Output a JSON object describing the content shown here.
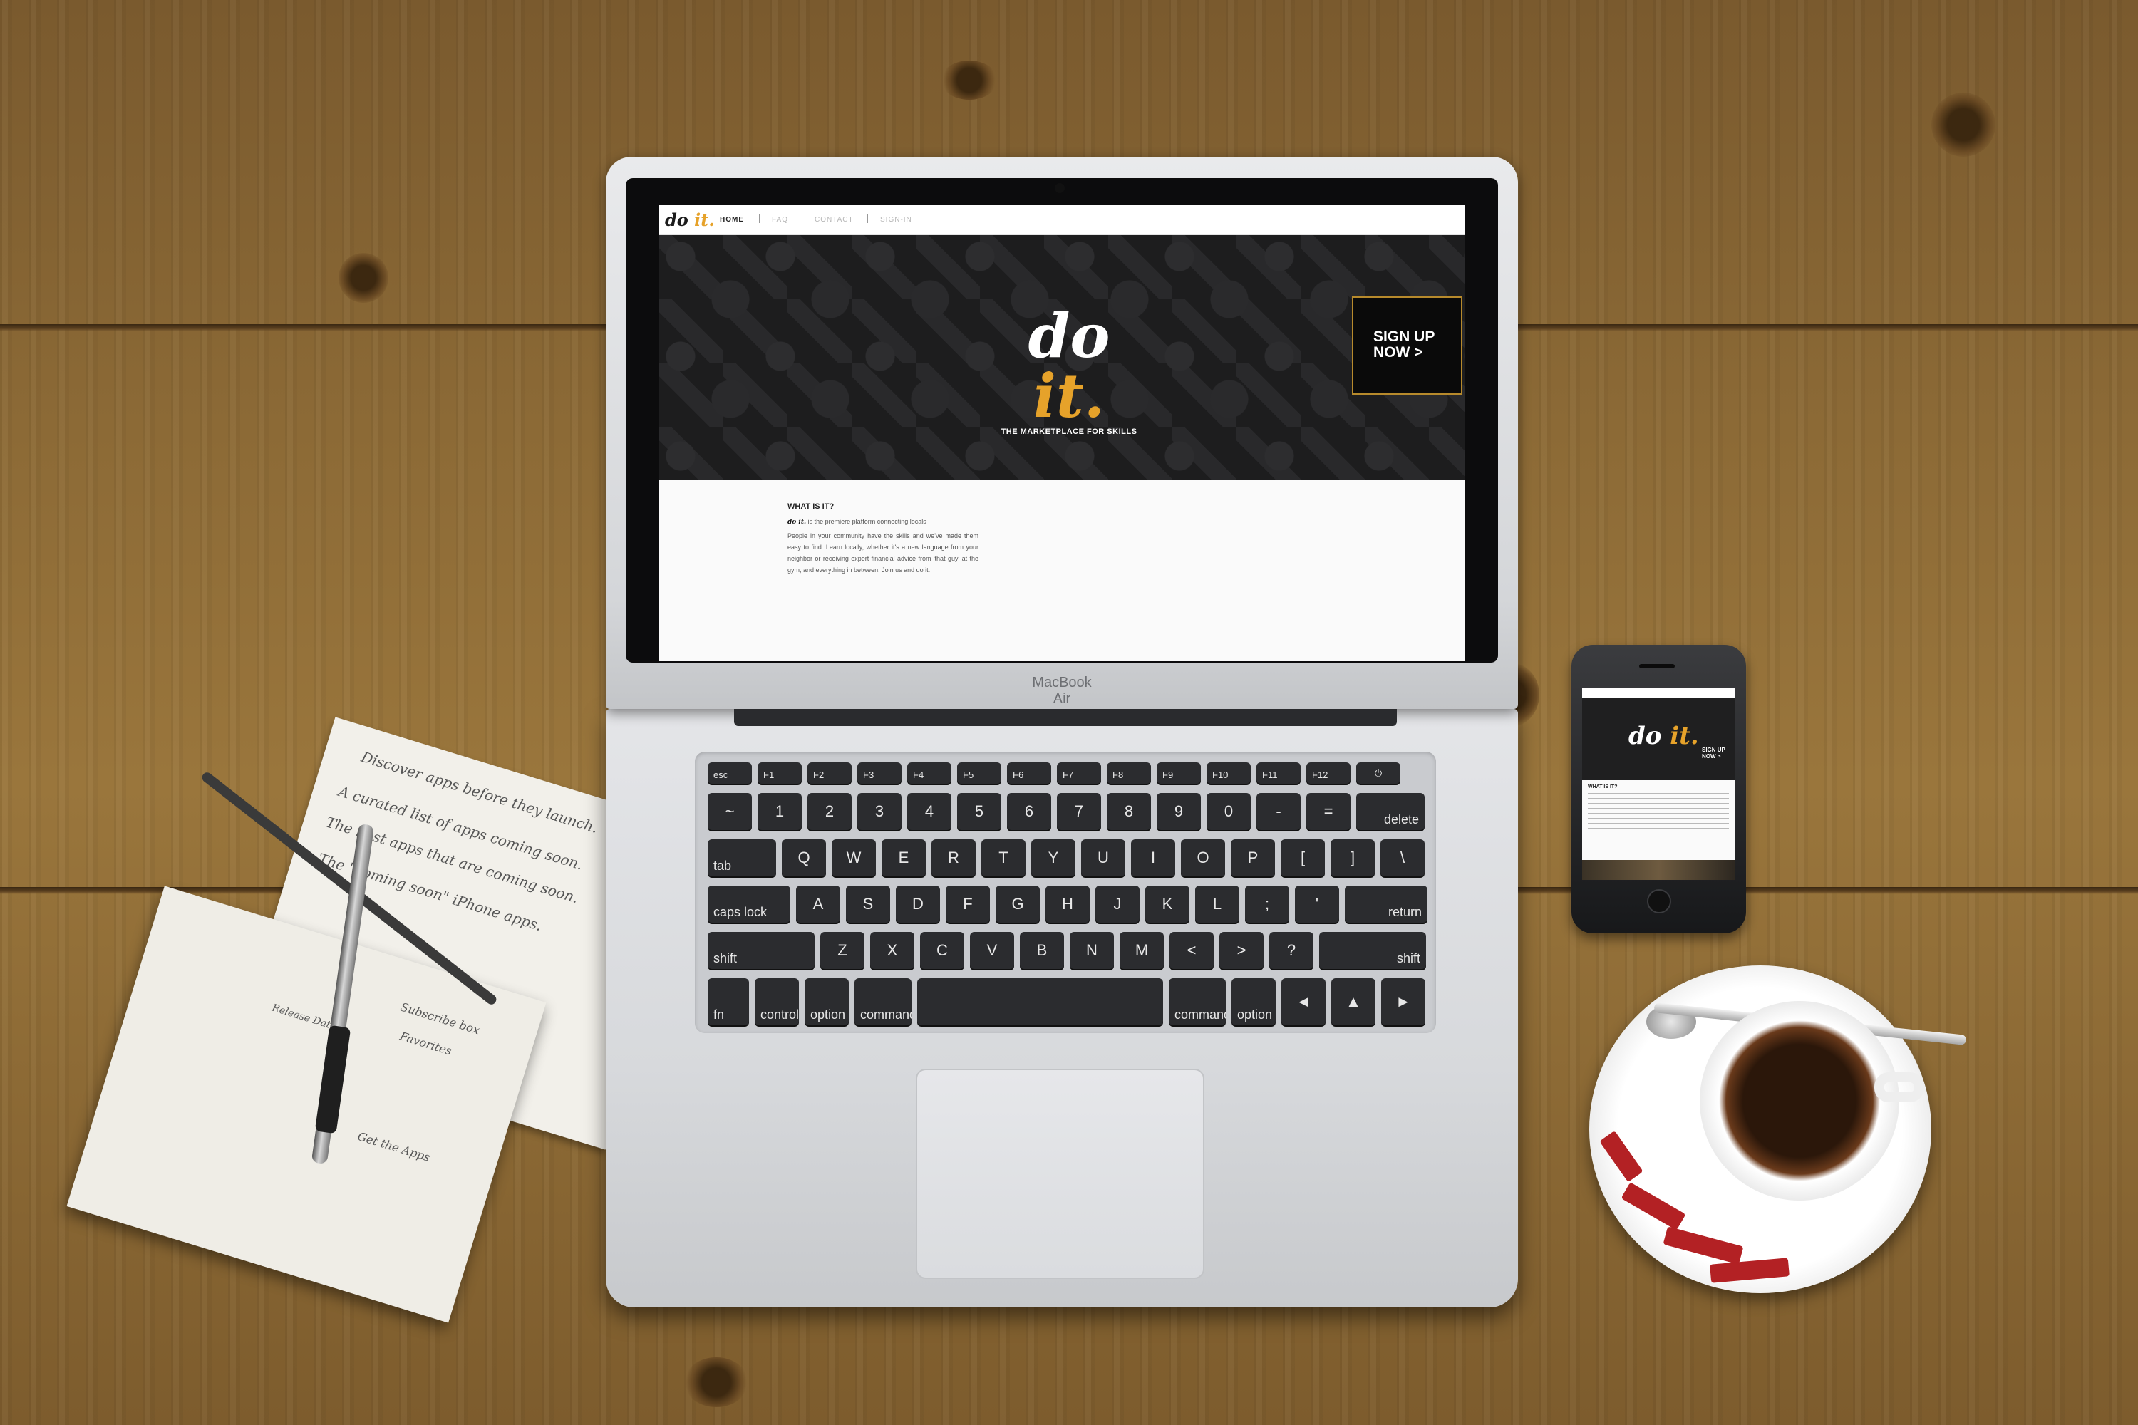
{
  "site": {
    "logo": {
      "do": "do",
      "it": "it."
    },
    "nav": [
      {
        "label": "HOME",
        "active": true
      },
      {
        "label": "FAQ",
        "active": false
      },
      {
        "label": "CONTACT",
        "active": false
      },
      {
        "label": "SIGN-IN",
        "active": false
      }
    ],
    "hero": {
      "logo_do": "do",
      "logo_it": "it.",
      "tagline": "THE MARKETPLACE FOR SKILLS",
      "signup_cta": "SIGN UP NOW >"
    },
    "content": {
      "heading": "WHAT IS IT?",
      "intro_brand": "do it.",
      "intro_text": "is the premiere platform connecting locals",
      "body": "People in your community have the skills and we've made them easy to find. Learn locally, whether it's a new language from your neighbor or receiving expert financial advice from 'that guy' at the gym, and everything in between. Join us and do it."
    }
  },
  "device": {
    "laptop_brand": "MacBook Air"
  },
  "phone": {
    "logo_do": "do",
    "logo_it": "it.",
    "signup": "SIGN UP NOW >",
    "heading": "WHAT IS IT?"
  },
  "notebook": {
    "lines": [
      "Discover apps before they launch.",
      "A curated list of apps coming soon.",
      "The best apps that are coming soon.",
      "The \"coming soon\" iPhone apps."
    ],
    "sketch_notes": [
      "Subscribe box",
      "Favorites",
      "Release Date",
      "Get the Apps"
    ]
  },
  "keyboard": {
    "row0": [
      "esc",
      "F1",
      "F2",
      "F3",
      "F4",
      "F5",
      "F6",
      "F7",
      "F8",
      "F9",
      "F10",
      "F11",
      "F12",
      "⏻"
    ],
    "row1": [
      "~",
      "1",
      "2",
      "3",
      "4",
      "5",
      "6",
      "7",
      "8",
      "9",
      "0",
      "-",
      "=",
      "delete"
    ],
    "row2": [
      "tab",
      "Q",
      "W",
      "E",
      "R",
      "T",
      "Y",
      "U",
      "I",
      "O",
      "P",
      "[",
      "]",
      "\\"
    ],
    "row3": [
      "caps lock",
      "A",
      "S",
      "D",
      "F",
      "G",
      "H",
      "J",
      "K",
      "L",
      ";",
      "'",
      "return"
    ],
    "row4": [
      "shift",
      "Z",
      "X",
      "C",
      "V",
      "B",
      "N",
      "M",
      "<",
      ">",
      "?",
      "shift"
    ],
    "row5": [
      "fn",
      "control",
      "option",
      "command",
      "",
      "command",
      "option",
      "◄",
      "▲",
      "►"
    ]
  },
  "colors": {
    "accent": "#e6a22a",
    "hero_bg": "#1d1d1e",
    "wood": "#8c6a36"
  }
}
